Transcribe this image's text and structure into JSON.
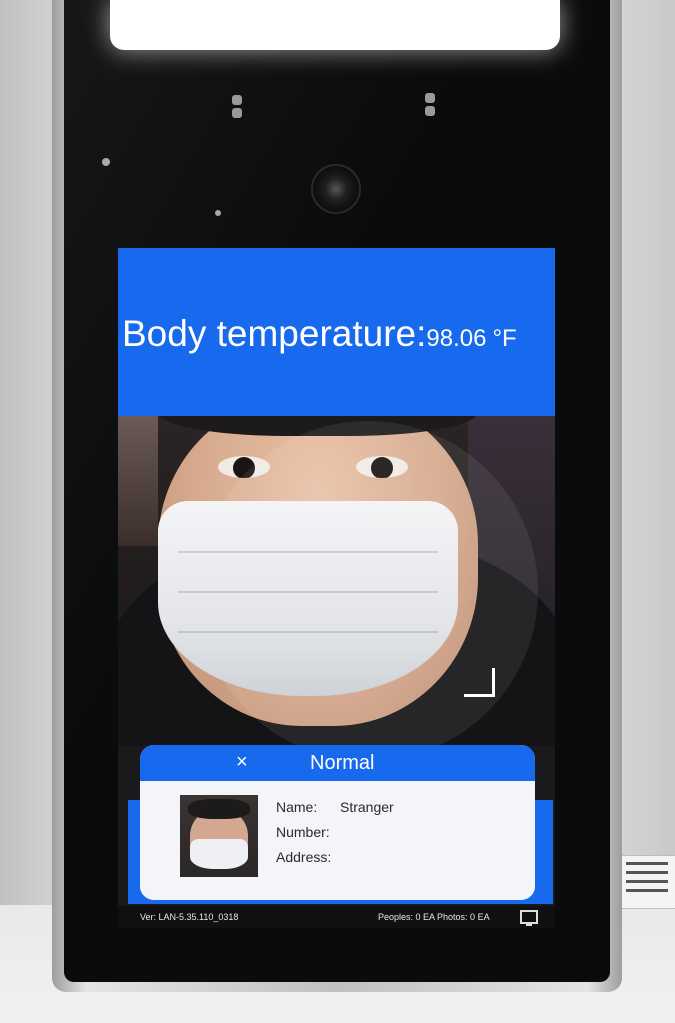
{
  "temperature": {
    "label": "Body temperature:",
    "value": "98.06",
    "unit": "°F"
  },
  "card": {
    "close_glyph": "×",
    "status": "Normal",
    "fields": [
      {
        "label": "Name:",
        "value": "Stranger"
      },
      {
        "label": "Number:",
        "value": ""
      },
      {
        "label": "Address:",
        "value": ""
      }
    ]
  },
  "status_bar": {
    "version": "Ver: LAN-5.35.110_0318",
    "counts": "Peoples: 0 EA   Photos: 0 EA",
    "icon": "monitor-icon"
  },
  "colors": {
    "banner_blue": "#1769ee"
  }
}
